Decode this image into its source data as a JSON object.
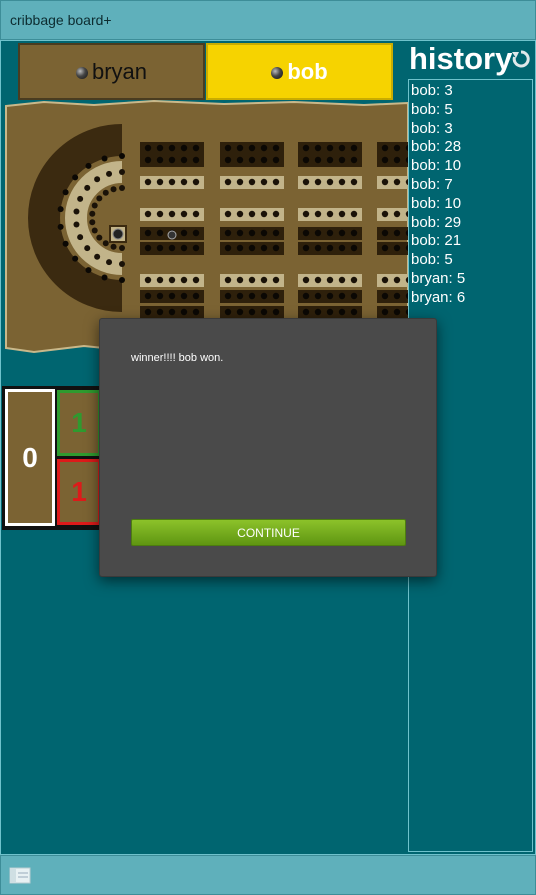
{
  "app": {
    "title": "cribbage board+"
  },
  "players": [
    {
      "name": "bryan",
      "active": false
    },
    {
      "name": "bob",
      "active": true
    }
  ],
  "history": {
    "title": "history",
    "entries": [
      "bob: 3",
      "bob: 5",
      "bob: 3",
      "bob: 28",
      "bob: 10",
      "bob: 7",
      "bob: 10",
      "bob: 29",
      "bob: 21",
      "bob: 5",
      "bryan: 5",
      "bryan: 6"
    ]
  },
  "scores": {
    "main": "0",
    "green": "1",
    "red": "1"
  },
  "dialog": {
    "message": "winner!!!! bob won.",
    "continue_label": "CONTINUE"
  },
  "colors": {
    "accent": "#f6d300",
    "background": "#006570",
    "bar": "#5fb0bb",
    "board": "#7b6333",
    "button": "#76ad1e"
  },
  "icons": {
    "refresh": "refresh-icon",
    "menu": "menu-icon",
    "peg": "peg-icon"
  }
}
